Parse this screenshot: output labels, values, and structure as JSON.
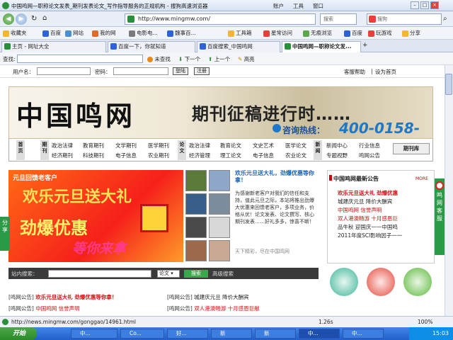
{
  "window": {
    "title": "中国鸣网—职称论文发表_期刊发表论文_写作指导服务的正规机构 - 搜狗高速浏览器",
    "menu": [
      "账户",
      "工具",
      "窗口"
    ]
  },
  "address": {
    "url": "http://www.mingmw.com/",
    "search_placeholder": "搜索",
    "engine_placeholder": "搜狗"
  },
  "favorites": [
    "收藏夹",
    "百度",
    "网站",
    "我的网",
    "电影电...",
    "魏事百...",
    "工具箱",
    "星常访问",
    "无痕浏览",
    "百度",
    "玩游戏",
    "分享"
  ],
  "tabs": [
    {
      "label": "主页 - 网址大全",
      "active": false
    },
    {
      "label": "百度一下，你就知道",
      "active": false
    },
    {
      "label": "百度搜索_中国鸣网",
      "active": false
    },
    {
      "label": "中国鸣网—职称论文发...",
      "active": true
    }
  ],
  "findbar": {
    "label": "查找:",
    "find_prev": "未查找",
    "next": "下一个",
    "prev": "上一个",
    "highlight": "高亮"
  },
  "login": {
    "user_label": "用户名：",
    "pass_label": "密码：",
    "login_btn": "登陆",
    "register_btn": "注册",
    "help": "客服帮助",
    "homepage": "设为首页",
    "sep": "|"
  },
  "banner": {
    "logo": "中国鸣网",
    "slogan": "期刊征稿进行时……",
    "hotline_label": "咨询热线：",
    "hotline": "400-0158-919"
  },
  "catnav": {
    "home": "首页",
    "journal": "期刊",
    "paper": "论文",
    "news": "新闻",
    "journal_links": [
      "政治法律",
      "教育期刊",
      "文学期刊",
      "医学期刊",
      "经济期刊",
      "科技期刊",
      "电子信息",
      "农业期刊"
    ],
    "paper_links": [
      "政治法律",
      "教育论文",
      "文史艺术",
      "医学论文",
      "经济管理",
      "理工论文",
      "电子信息",
      "农业论文"
    ],
    "news_links": [
      "新闻中心",
      "行业信息",
      "专题视野",
      "鸣网公告"
    ],
    "library": "期刊库"
  },
  "promo": {
    "line1": "元旦回馈老客户",
    "line2": "欢乐元旦送大礼",
    "line3": "劲爆优惠",
    "line4": "等你来拿"
  },
  "news": {
    "headline": "欢乐元旦送大礼，劲爆优惠等你拿！",
    "body": "为感谢新老客户对我们的信任和支持，值此元旦之际，本站将推出劲爆大优惠来回馈老客户，多项业务，价格从优！论文发表、论文撰写、核心期刊发表……好礼多多，惊喜不断！",
    "footer": "天下精彩，尽在中国鸣网"
  },
  "search": {
    "label": "站内搜索：",
    "scope": "论文",
    "button": "搜索",
    "advanced": "高级搜索"
  },
  "notices": [
    {
      "tag": "[鸣网公告]",
      "text": "欢乐元旦送大礼 劲爆优惠等你拿！",
      "style": "red bold"
    },
    {
      "tag": "[鸣网公告]",
      "text": "城建庆元旦 降价大酬宾",
      "style": ""
    },
    {
      "tag": "[鸣网公告]",
      "text": "中国鸣网 信誉声明",
      "style": "red"
    },
    {
      "tag": "[鸣网公告]",
      "text": "双人港澳畅游 十月感恩巨献",
      "style": "red"
    }
  ],
  "rpanel": {
    "title": "中国鸣网最新公告",
    "more": "MORE",
    "items": [
      {
        "text": "欢乐元旦送大礼 劲爆优惠",
        "color": "red"
      },
      {
        "text": "城建庆元旦 降价大酬宾",
        "color": "black"
      },
      {
        "text": "中国鸣网 信誉声明",
        "color": "red"
      },
      {
        "text": "双人港澳畅游 十月感恩巨",
        "color": "red"
      },
      {
        "text": "品牛秋 迎国庆一一中国鸣",
        "color": "black"
      },
      {
        "text": "2011年度SCI影响因子一一",
        "color": "black"
      }
    ],
    "circles": [
      "在线投稿",
      "写作指导",
      "免费咨询"
    ]
  },
  "side": {
    "share": "分享",
    "service": "鸣网客服"
  },
  "status": {
    "url": "http://news.mingmw.com/gonggao/14961.html",
    "zoom": "1.26s",
    "percent": "100%"
  },
  "taskbar": {
    "start": "开始",
    "tasks": [
      "中...",
      "Co...",
      "好...",
      "新",
      "新",
      "中...",
      "中..."
    ],
    "clock": "15:03"
  },
  "colors": {
    "accent_green": "#2b9a46",
    "hotline_blue": "#1d78c8",
    "promo_red": "#f5201a"
  }
}
